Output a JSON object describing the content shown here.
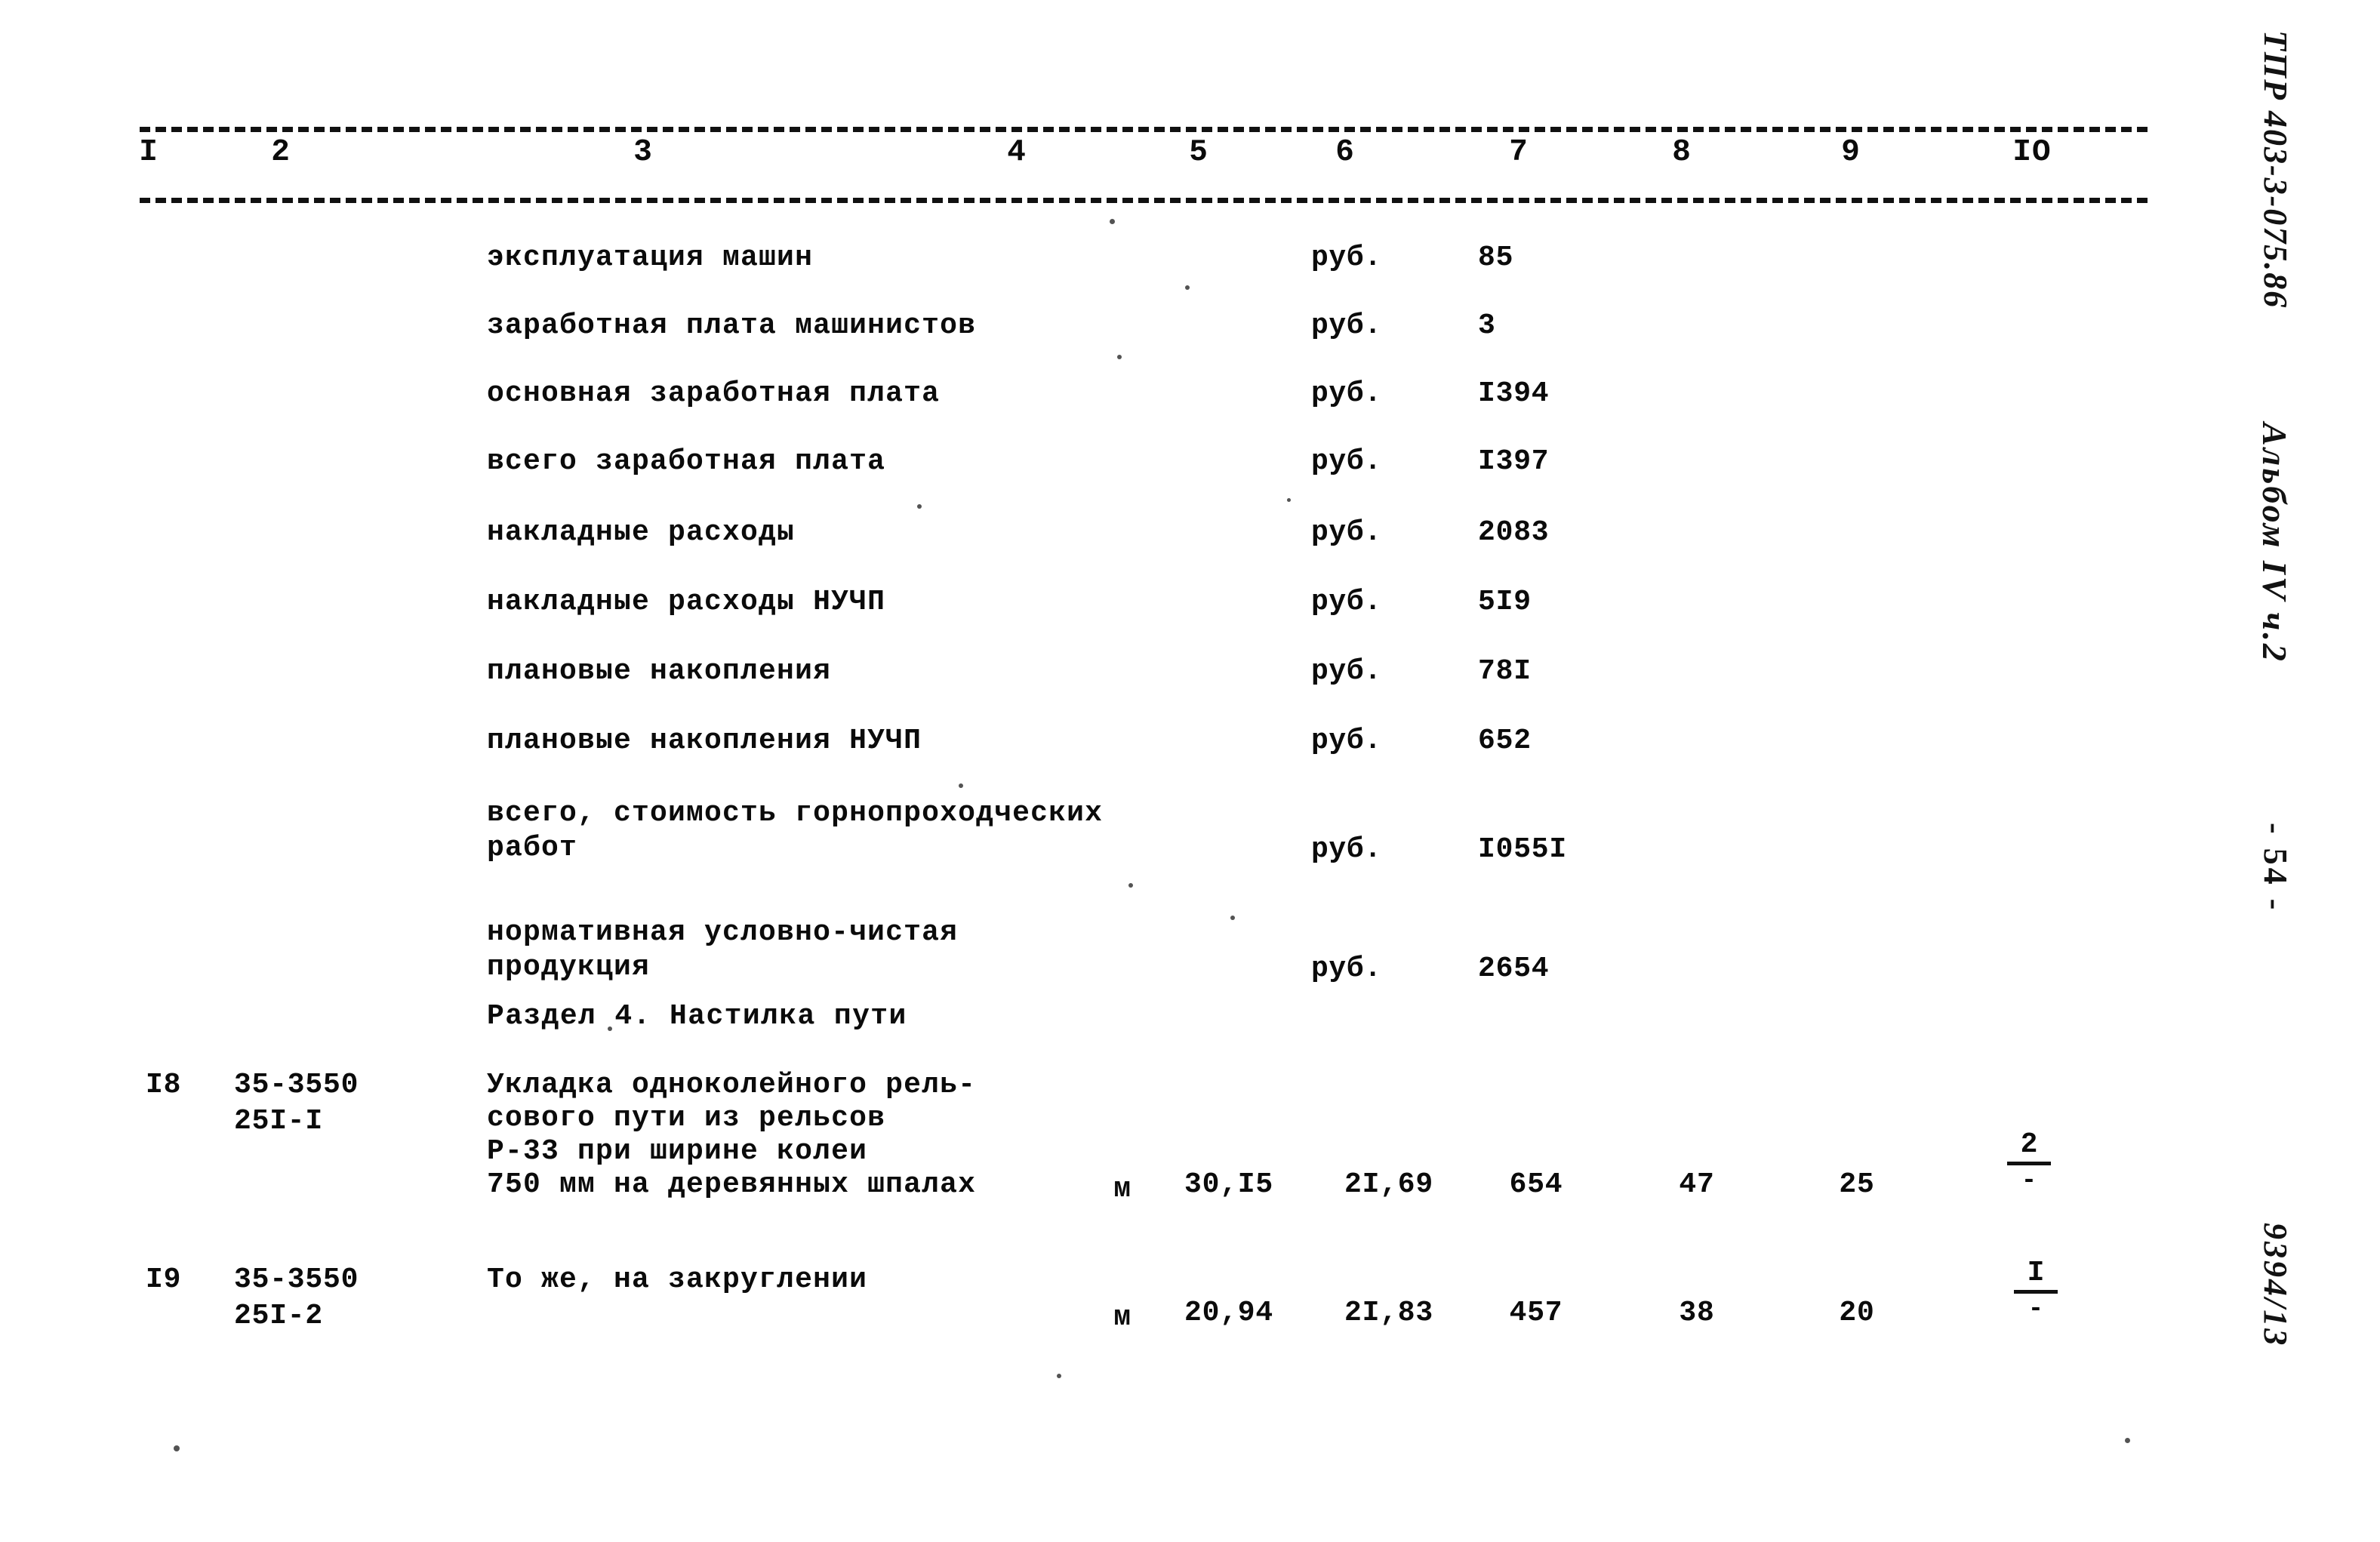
{
  "document": {
    "page_number_label": "- 54 -",
    "margin_notes": {
      "project_code": "ТПР 403-3-075.86",
      "album": "Альбом IV ч.2",
      "archive_number": "9394/13"
    }
  },
  "table": {
    "column_numbers": [
      "I",
      "2",
      "3",
      "4",
      "5",
      "6",
      "7",
      "8",
      "9",
      "IO"
    ],
    "cost_item_rows": [
      {
        "description": "эксплуатация машин",
        "unit": "руб.",
        "value": "85"
      },
      {
        "description": "заработная плата машинистов",
        "unit": "руб.",
        "value": "3"
      },
      {
        "description": "основная заработная плата",
        "unit": "руб.",
        "value": "I394"
      },
      {
        "description": "всего заработная плата",
        "unit": "руб.",
        "value": "I397"
      },
      {
        "description": "накладные расходы",
        "unit": "руб.",
        "value": "2083"
      },
      {
        "description": "накладные расходы НУЧП",
        "unit": "руб.",
        "value": "5I9"
      },
      {
        "description": "плановые накопления",
        "unit": "руб.",
        "value": "78I"
      },
      {
        "description": "плановые накопления НУЧП",
        "unit": "руб.",
        "value": "652"
      },
      {
        "description_line1": "всего, стоимость горнопроходческих",
        "description_line2": "работ",
        "unit": "руб.",
        "value": "I055I"
      },
      {
        "description_line1": "нормативная условно-чистая",
        "description_line2": "продукция",
        "unit": "руб.",
        "value": "2654"
      }
    ],
    "section_heading": "Раздел 4. Настилка пути",
    "work_rows": [
      {
        "number": "I8",
        "code_line1": "35-3550",
        "code_line2": "25I-I",
        "description_line1": "Укладка одноколейного рель-",
        "description_line2": "сового пути из рельсов",
        "description_line3": "Р-33 при ширине колеи",
        "description_line4": "750 мм на деревянных шпалах",
        "unit": "м",
        "col5": "30,I5",
        "col6": "2I,69",
        "col7": "654",
        "col8": "47",
        "col9": "25",
        "col10_numerator": "2",
        "col10_denominator": "-"
      },
      {
        "number": "I9",
        "code_line1": "35-3550",
        "code_line2": "25I-2",
        "description_line1": "То же, на закруглении",
        "unit": "м",
        "col5": "20,94",
        "col6": "2I,83",
        "col7": "457",
        "col8": "38",
        "col9": "20",
        "col10_numerator": "I",
        "col10_denominator": "-"
      }
    ]
  }
}
